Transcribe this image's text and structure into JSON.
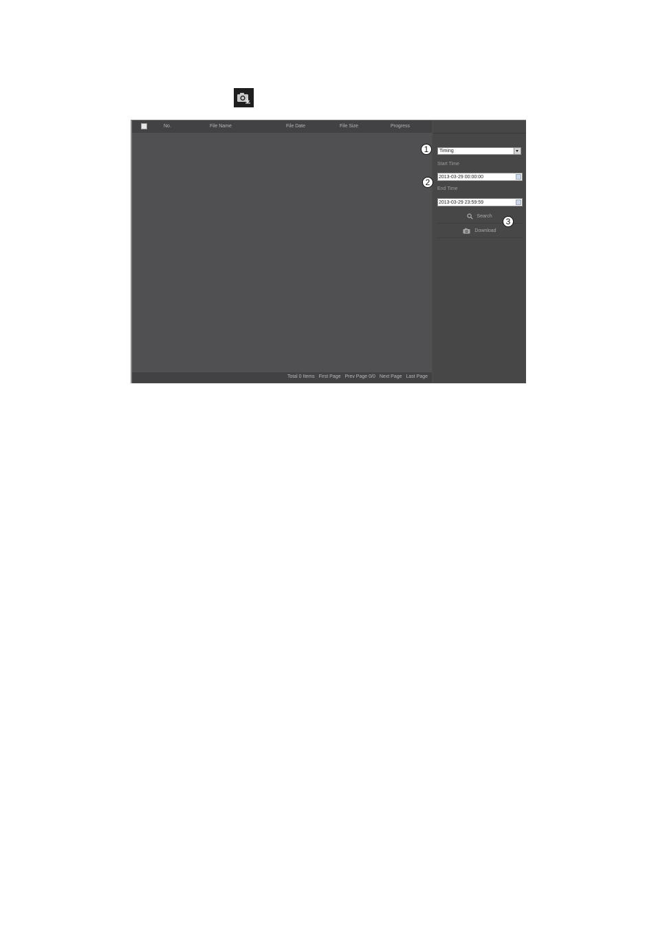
{
  "doc_icon": "camera-download-icon",
  "table": {
    "headers": [
      "No.",
      "File Name",
      "File Date",
      "File Size",
      "Progress"
    ]
  },
  "pager": {
    "total": "Total 0 Items",
    "first": "First Page",
    "prev": "Prev Page",
    "page": "0/0",
    "next": "Next Page",
    "last": "Last Page"
  },
  "panel": {
    "type_value": "Timing",
    "start_label": "Start Time",
    "start_value": "2013-03-29 00:00:00",
    "end_label": "End Time",
    "end_value": "2013-03-29 23:59:59",
    "search_label": "Search",
    "download_label": "Download"
  },
  "callouts": [
    "1",
    "2",
    "3"
  ]
}
